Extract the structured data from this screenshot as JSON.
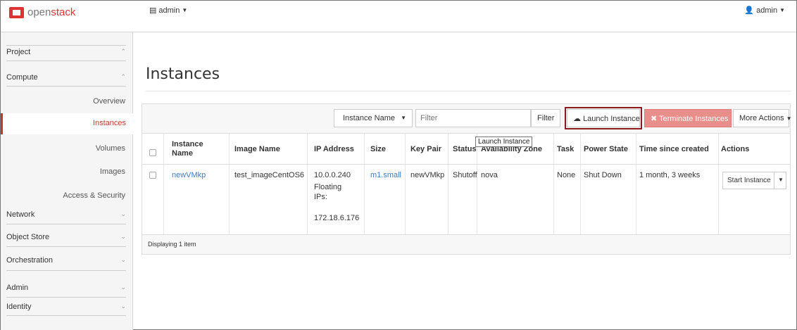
{
  "brand": {
    "name_plain": "open",
    "name_accent": "stack"
  },
  "header": {
    "project_menu": "admin",
    "user_menu": "admin"
  },
  "sidebar": {
    "sections": [
      "Project",
      "Compute",
      "Network",
      "Object Store",
      "Orchestration",
      "Admin",
      "Identity"
    ],
    "compute_items": [
      "Overview",
      "Instances",
      "Volumes",
      "Images",
      "Access & Security"
    ],
    "active_item": "Instances"
  },
  "page": {
    "title": "Instances"
  },
  "toolbar": {
    "filter_field_select": "Instance Name",
    "filter_placeholder": "Filter",
    "filter_button": "Filter",
    "launch_button": "Launch Instance",
    "terminate_button": "Terminate Instances",
    "more_actions_button": "More Actions"
  },
  "tooltip": "Launch Instance",
  "table": {
    "columns": [
      "Instance Name",
      "Image Name",
      "IP Address",
      "Size",
      "Key Pair",
      "Status",
      "Availability Zone",
      "Task",
      "Power State",
      "Time since created",
      "Actions"
    ],
    "rows": [
      {
        "instance_name": "newVMkp",
        "image_name": "test_imageCentOS6",
        "ip_address": "10.0.0.240",
        "floating_label": "Floating IPs:",
        "floating_ip": "172.18.6.176",
        "size": "m1.small",
        "key_pair": "newVMkp",
        "status": "Shutoff",
        "availability_zone": "nova",
        "task": "None",
        "power_state": "Shut Down",
        "time_since_created": "1 month, 3 weeks",
        "action": "Start Instance"
      }
    ],
    "footer": "Displaying 1 item"
  }
}
